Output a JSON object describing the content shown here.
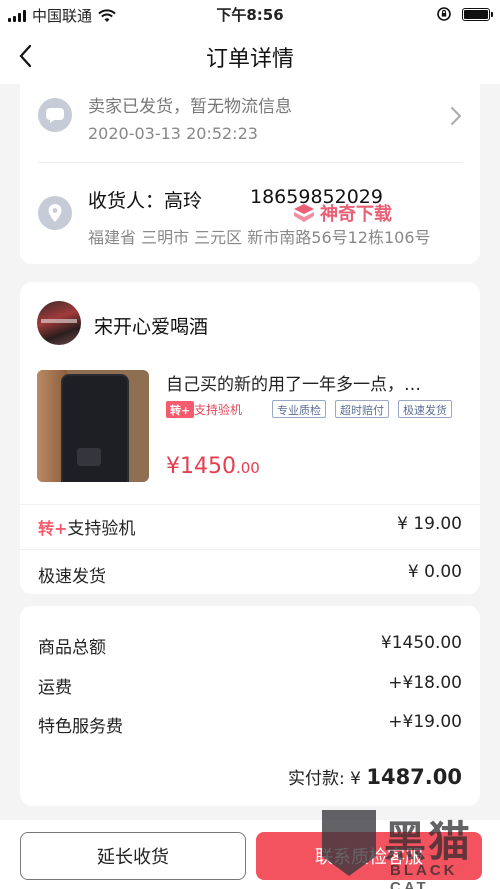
{
  "status_bar": {
    "carrier": "中国联通",
    "time": "下午8:56",
    "battery_level": 1.0
  },
  "nav": {
    "title": "订单详情"
  },
  "logistics": {
    "status": "卖家已发货，暂无物流信息",
    "time": "2020-03-13 20:52:23"
  },
  "address": {
    "recipient": "收货人：高玲",
    "phone": "18659852029",
    "detail": "福建省 三明市 三元区 新市南路56号12栋106号"
  },
  "watermark": {
    "text": "神奇下载"
  },
  "shop": {
    "name": "宋开心爱喝酒"
  },
  "product": {
    "title": "自己买的新的用了一年多一点，…",
    "zhuan_tag": "转+",
    "support_tag": "支持验机",
    "badges": [
      "专业质检",
      "超时赔付",
      "极速发货"
    ],
    "price_symbol": "¥",
    "price_int": "1450",
    "price_dec": ".00"
  },
  "services": [
    {
      "icon": "转+",
      "label": "支持验机",
      "value": "¥ 19.00"
    },
    {
      "icon": "",
      "label": "极速发货",
      "value": "¥ 0.00"
    }
  ],
  "summary": {
    "items": [
      {
        "label": "商品总额",
        "value": "¥1450.00"
      },
      {
        "label": "运费",
        "value": "+¥18.00"
      },
      {
        "label": "特色服务费",
        "value": "+¥19.00"
      }
    ],
    "paid_label": "实付款: ",
    "paid_symbol": "¥ ",
    "paid_value": "1487.00"
  },
  "actions": {
    "extend_label": "延长收货",
    "service_label": "联系质检客服"
  },
  "overlay_logo": {
    "text_cn": "黑猫",
    "text_en": "BLACK CAT"
  }
}
